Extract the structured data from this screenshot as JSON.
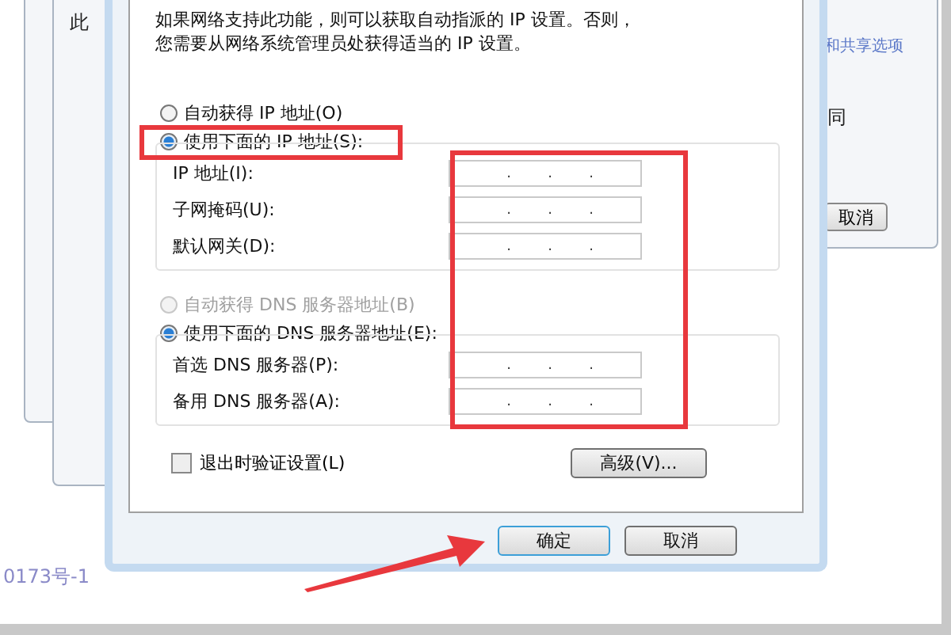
{
  "background": {
    "left_window_text": "此",
    "right_window": {
      "link": "和共享选项",
      "text": "同",
      "button": "取消"
    },
    "footer_text": "0173号-1"
  },
  "dialog": {
    "intro": [
      "如果网络支持此功能，则可以获取自动指派的 IP 设置。否则，",
      "您需要从网络系统管理员处获得适当的 IP 设置。"
    ],
    "separator": ".",
    "sections": [
      {
        "options": [
          {
            "label": "自动获得 IP 地址(O)",
            "selected": false,
            "disabled": false
          },
          {
            "label": "使用下面的 IP 地址(S):",
            "selected": true,
            "disabled": false
          }
        ],
        "fields": [
          {
            "label": "IP 地址(I):"
          },
          {
            "label": "子网掩码(U):"
          },
          {
            "label": "默认网关(D):"
          }
        ]
      },
      {
        "options": [
          {
            "label": "自动获得 DNS 服务器地址(B)",
            "selected": false,
            "disabled": true
          },
          {
            "label": "使用下面的 DNS 服务器地址(E):",
            "selected": true,
            "disabled": false
          }
        ],
        "fields": [
          {
            "label": "首选 DNS 服务器(P):"
          },
          {
            "label": "备用 DNS 服务器(A):"
          }
        ]
      }
    ],
    "validate": {
      "label": "退出时验证设置(L)",
      "checked": false
    },
    "advanced_button": "高级(V)...",
    "buttons": [
      {
        "label": "确定",
        "selected": true
      },
      {
        "label": "取消",
        "selected": false
      }
    ]
  }
}
